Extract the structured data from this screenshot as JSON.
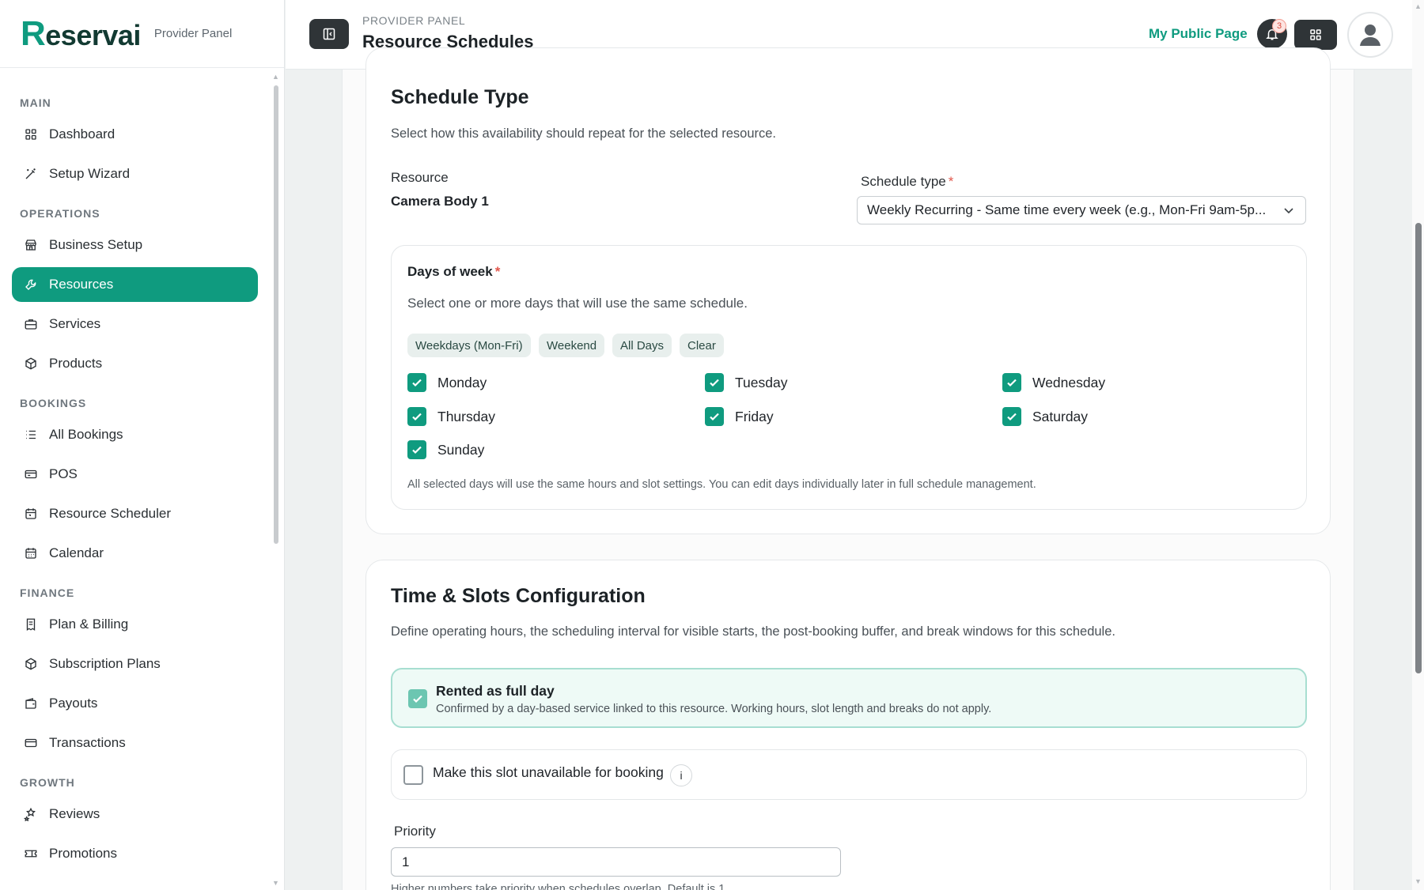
{
  "brand": {
    "logo_initial": "R",
    "logo_rest": "eservai",
    "subtitle": "Provider Panel"
  },
  "header": {
    "kicker": "PROVIDER PANEL",
    "title": "Resource Schedules",
    "public_link": "My Public Page",
    "notification_count": "3"
  },
  "sidebar": {
    "sections": {
      "main": "MAIN",
      "operations": "OPERATIONS",
      "bookings": "BOOKINGS",
      "finance": "FINANCE",
      "growth": "GROWTH"
    },
    "items": {
      "dashboard": "Dashboard",
      "setup_wizard": "Setup Wizard",
      "business_setup": "Business Setup",
      "resources": "Resources",
      "services": "Services",
      "products": "Products",
      "all_bookings": "All Bookings",
      "pos": "POS",
      "resource_scheduler": "Resource Scheduler",
      "calendar": "Calendar",
      "plan_billing": "Plan & Billing",
      "subscription_plans": "Subscription Plans",
      "payouts": "Payouts",
      "transactions": "Transactions",
      "reviews": "Reviews",
      "promotions": "Promotions"
    },
    "active_item": "resources"
  },
  "schedule_type": {
    "title": "Schedule Type",
    "subtitle": "Select how this availability should repeat for the selected resource.",
    "resource_label": "Resource",
    "resource_value": "Camera Body 1",
    "type_label": "Schedule type",
    "required_mark": "*",
    "type_value": "Weekly Recurring - Same time every week (e.g., Mon-Fri 9am-5p...",
    "days": {
      "label": "Days of week",
      "hint": "Select one or more days that will use the same schedule.",
      "chips": [
        "Weekdays (Mon-Fri)",
        "Weekend",
        "All Days",
        "Clear"
      ],
      "list": [
        {
          "name": "Monday",
          "checked": true
        },
        {
          "name": "Tuesday",
          "checked": true
        },
        {
          "name": "Wednesday",
          "checked": true
        },
        {
          "name": "Thursday",
          "checked": true
        },
        {
          "name": "Friday",
          "checked": true
        },
        {
          "name": "Saturday",
          "checked": true
        },
        {
          "name": "Sunday",
          "checked": true
        }
      ],
      "note": "All selected days will use the same hours and slot settings. You can edit days individually later in full schedule management."
    }
  },
  "time_slots": {
    "title": "Time & Slots Configuration",
    "subtitle": "Define operating hours, the scheduling interval for visible starts, the post-booking buffer, and break windows for this schedule.",
    "full_day": {
      "checked": true,
      "title": "Rented as full day",
      "description": "Confirmed by a day-based service linked to this resource. Working hours, slot length and breaks do not apply."
    },
    "unavailable": {
      "checked": false,
      "label": "Make this slot unavailable for booking",
      "info_glyph": "i"
    },
    "priority": {
      "label": "Priority",
      "value": "1",
      "hint": "Higher numbers take priority when schedules overlap. Default is 1."
    }
  },
  "colors": {
    "accent": "#0f9b7f",
    "dark_button": "#2f3437",
    "required": "#e2574c"
  }
}
